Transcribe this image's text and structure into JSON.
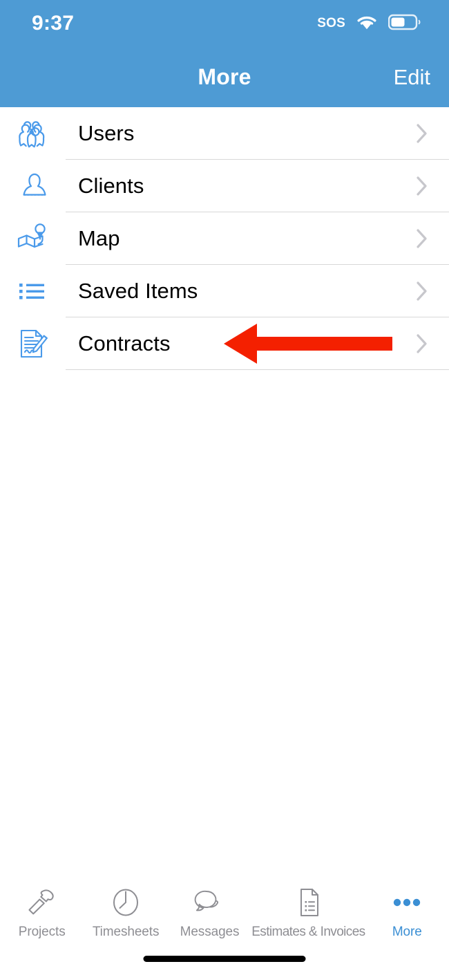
{
  "status_bar": {
    "time": "9:37",
    "sos_label": "SOS",
    "wifi_icon": "wifi-icon",
    "battery_icon": "battery-icon",
    "battery_level_percent": 55
  },
  "nav": {
    "title": "More",
    "edit_label": "Edit",
    "background_color": "#4e9bd4",
    "text_color": "#ffffff"
  },
  "theme": {
    "accent_blue": "#4e9bd4",
    "icon_blue": "#4a9aea",
    "tab_inactive": "#8e8e93",
    "tab_active": "#3b8fd4",
    "separator": "#d8d8d8",
    "chevron": "#c7c7cc",
    "annotation_red": "#f42000"
  },
  "list": {
    "items": [
      {
        "label": "Users",
        "icon": "users-group-icon",
        "chevron": "chevron-right-icon"
      },
      {
        "label": "Clients",
        "icon": "person-icon",
        "chevron": "chevron-right-icon"
      },
      {
        "label": "Map",
        "icon": "map-pin-icon",
        "chevron": "chevron-right-icon"
      },
      {
        "label": "Saved Items",
        "icon": "bulleted-list-icon",
        "chevron": "chevron-right-icon"
      },
      {
        "label": "Contracts",
        "icon": "contract-signature-icon",
        "chevron": "chevron-right-icon"
      }
    ]
  },
  "annotation": {
    "type": "arrow-left",
    "color": "#f42000",
    "points_at": "Contracts"
  },
  "tab_bar": {
    "items": [
      {
        "label": "Projects",
        "icon": "hammer-icon",
        "active": false
      },
      {
        "label": "Timesheets",
        "icon": "clock-icon",
        "active": false
      },
      {
        "label": "Messages",
        "icon": "speech-bubbles-icon",
        "active": false
      },
      {
        "label": "Estimates & Invoices",
        "icon": "document-list-icon",
        "active": false
      },
      {
        "label": "More",
        "icon": "ellipsis-icon",
        "active": true
      }
    ]
  }
}
